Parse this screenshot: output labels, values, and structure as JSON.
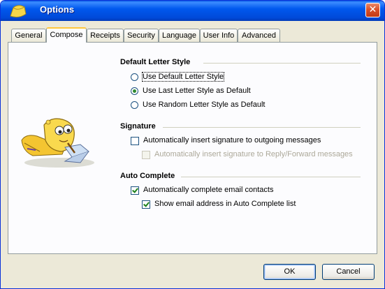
{
  "window": {
    "title": "Options"
  },
  "tabs": [
    {
      "label": "General"
    },
    {
      "label": "Compose"
    },
    {
      "label": "Receipts"
    },
    {
      "label": "Security"
    },
    {
      "label": "Language"
    },
    {
      "label": "User Info"
    },
    {
      "label": "Advanced"
    }
  ],
  "active_tab": "Compose",
  "default_letter_style": {
    "title": "Default Letter Style",
    "options": [
      {
        "label": "Use Default Letter Style",
        "checked": false
      },
      {
        "label": "Use Last Letter Style as Default",
        "checked": true
      },
      {
        "label": "Use Random Letter Style as Default",
        "checked": false
      }
    ]
  },
  "signature": {
    "title": "Signature",
    "auto_insert": {
      "label": "Automatically insert signature to outgoing messages",
      "checked": false
    },
    "reply_forward": {
      "label": "Automatically insert signature to Reply/Forward messages",
      "checked": false,
      "enabled": false
    }
  },
  "auto_complete": {
    "title": "Auto Complete",
    "complete_contacts": {
      "label": "Automatically complete email contacts",
      "checked": true
    },
    "show_address": {
      "label": "Show email address in Auto Complete list",
      "checked": true
    }
  },
  "buttons": {
    "ok": "OK",
    "cancel": "Cancel"
  }
}
